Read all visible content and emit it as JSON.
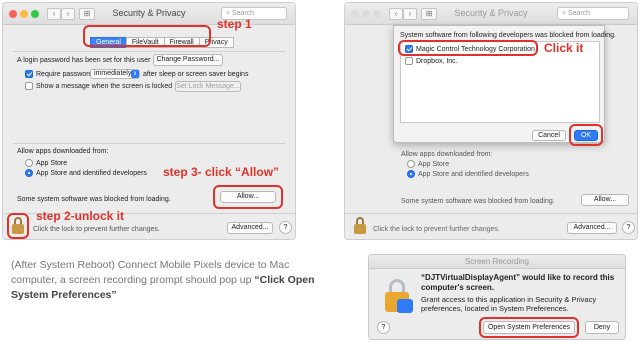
{
  "left_window": {
    "title": "Security & Privacy",
    "search_placeholder": "Search",
    "tabs": [
      "General",
      "FileVault",
      "Firewall",
      "Privacy"
    ],
    "selected_tab": "General",
    "login_text": "A login password has been set for this user",
    "change_password_label": "Change Password...",
    "require_password_label": "Require password",
    "require_password_value": "immediately",
    "require_password_suffix": "after sleep or screen saver begins",
    "show_message_label": "Show a message when the screen is locked",
    "set_lock_message_label": "Set Lock Message...",
    "allow_apps_heading": "Allow apps downloaded from:",
    "option_app_store": "App Store",
    "option_identified": "App Store and identified developers",
    "blocked_text": "Some system software was blocked from loading.",
    "allow_button": "Allow...",
    "lock_text": "Click the lock to prevent further changes.",
    "advanced_button": "Advanced...",
    "help_button": "?",
    "step1": "step 1",
    "step2": "step 2-unlock it",
    "step3": "step 3- click “Allow”"
  },
  "right_window": {
    "title": "Security & Privacy",
    "search_placeholder": "Search",
    "sheet_heading": "System software from following developers was blocked from loading.",
    "developers": [
      {
        "name": "Magic Control Technology Corporation",
        "checked": true
      },
      {
        "name": "Dropbox, Inc.",
        "checked": false
      }
    ],
    "click_it": "Click it",
    "cancel_button": "Cancel",
    "ok_button": "OK",
    "allow_apps_heading": "Allow apps downloaded from:",
    "option_app_store": "App Store",
    "option_identified": "App Store and identified developers",
    "blocked_text": "Some system software was blocked from loading.",
    "allow_button": "Allow...",
    "lock_text": "Click the lock to prevent further changes.",
    "advanced_button": "Advanced...",
    "help_button": "?"
  },
  "instructions": {
    "text": "(After System Reboot) Connect Mobile Pixels device to Mac computer, a screen recording prompt should pop up",
    "emphasis": "“Click Open System Preferences”"
  },
  "recording_dialog": {
    "title": "Screen Recording",
    "heading": "“DJTVirtualDisplayAgent” would like to record this computer's screen.",
    "body": "Grant access to this application in Security & Privacy preferences, located in System Preferences.",
    "help_button": "?",
    "open_button": "Open System Preferences",
    "deny_button": "Deny"
  },
  "colors": {
    "annotation_red": "#e0322a",
    "accent_blue": "#2f7af5"
  }
}
